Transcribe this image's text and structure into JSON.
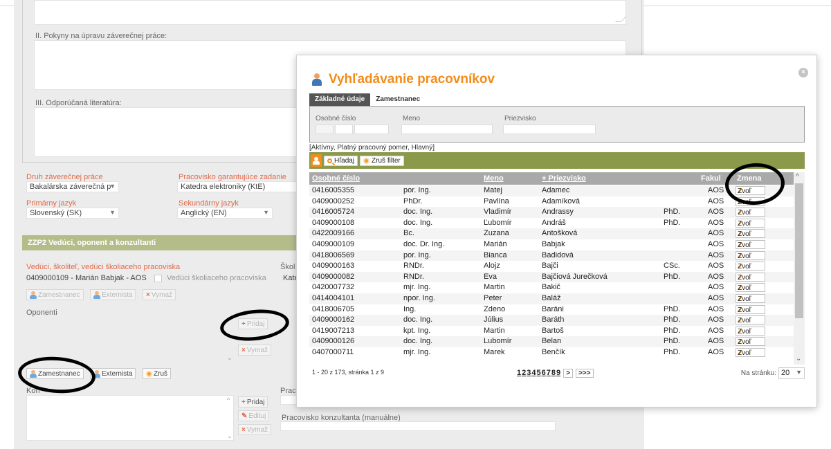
{
  "form": {
    "section2_label": "II. Pokyny na úpravu záverečnej práce:",
    "section3_label": "III. Odporúčaná literatúra:",
    "druh_label": "Druh záverečnej práce",
    "druh_value": "Bakalárska záverečná p",
    "pracovisko_label": "Pracovisko garantujúce zadanie",
    "pracovisko_value": "Katedra elektroniky (KtE)",
    "primarny_label": "Primárny jazyk",
    "primarny_value": "Slovenský (SK)",
    "sekundarny_label": "Sekundárny jazyk",
    "sekundarny_value": "Anglický (EN)",
    "zzp2_title": "ZZP2 Vedúci, oponent a konzultanti",
    "veduci_label": "Vedúci, školiteľ, vedúci školiaceho pracoviska",
    "veduci_value": "0409000109 - Marián Babjak - AOS",
    "veduci_checkbox_label": "Vedúci školiaceho pracoviska",
    "skol_label_partial": "Škol",
    "kat_partial": "Kate",
    "btn_zamestnanec": "Zamestnanec",
    "btn_externista": "Externista",
    "btn_vymaz": "Vymaž",
    "oponenti_label": "Oponenti",
    "btn_pridaj": "Pridaj",
    "btn_zrus": "Zruš",
    "konzultanti_label_partial": "Kon",
    "prac_partial": "Prac",
    "btn_edituj": "Edituj",
    "pracovisko_konzultanta_label": "Pracovisko konzultanta (manuálne)"
  },
  "modal": {
    "title": "Vyhľadávanie pracovníkov",
    "close_symbol": "×",
    "tabs": [
      "Základné údaje",
      "Zamestnanec"
    ],
    "filter_osobne": "Osobné číslo",
    "filter_meno": "Meno",
    "filter_priezvisko": "Priezvisko",
    "criteria": "[Aktívny, Platný pracovný pomer, Hlavný]",
    "btn_hladaj": "Hľadaj",
    "btn_zrus_filter": "Zruš filter",
    "columns": {
      "osobne": "Osobné číslo",
      "meno": "Meno",
      "priezvisko": "+ Priezvisko",
      "fakulta": "Fakul",
      "zmena": "Zmena"
    },
    "zvol_label": "Zvoľ",
    "rows": [
      [
        "0416005355",
        "por. Ing.",
        "Matej",
        "Adamec",
        "",
        "AOS"
      ],
      [
        "0409000252",
        "PhDr.",
        "Pavlína",
        "Adamíková",
        "",
        "AOS"
      ],
      [
        "0416005724",
        "doc. Ing.",
        "Vladimír",
        "Andrassy",
        "PhD.",
        "AOS"
      ],
      [
        "0409000108",
        "doc. Ing.",
        "Ľubomír",
        "Andráš",
        "PhD.",
        "AOS"
      ],
      [
        "0422009166",
        "Bc.",
        "Zuzana",
        "Antošková",
        "",
        "AOS"
      ],
      [
        "0409000109",
        "doc. Dr. Ing.",
        "Marián",
        "Babjak",
        "",
        "AOS"
      ],
      [
        "0418006569",
        "por. Ing.",
        "Bianca",
        "Badidová",
        "",
        "AOS"
      ],
      [
        "0409000163",
        "RNDr.",
        "Alojz",
        "Bajči",
        "CSc.",
        "AOS"
      ],
      [
        "0409000082",
        "RNDr.",
        "Eva",
        "Bajčiová Jurečková",
        "PhD.",
        "AOS"
      ],
      [
        "0420007732",
        "mjr. Ing.",
        "Martin",
        "Bakič",
        "",
        "AOS"
      ],
      [
        "0414004101",
        "npor. Ing.",
        "Peter",
        "Baláž",
        "",
        "AOS"
      ],
      [
        "0418006705",
        "Ing.",
        "Zdeno",
        "Baráni",
        "PhD.",
        "AOS"
      ],
      [
        "0409000162",
        "doc. Ing.",
        "Július",
        "Baráth",
        "PhD.",
        "AOS"
      ],
      [
        "0419007213",
        "kpt. Ing.",
        "Martin",
        "Bartoš",
        "PhD.",
        "AOS"
      ],
      [
        "0409000126",
        "doc. Ing.",
        "Lubomír",
        "Belan",
        "PhD.",
        "AOS"
      ],
      [
        "0407000711",
        "mjr. Ing.",
        "Marek",
        "Benčík",
        "PhD.",
        "AOS"
      ]
    ],
    "pager_info": "1 - 20 z 173, stránka 1 z 9",
    "pages": [
      "1",
      "2",
      "3",
      "4",
      "5",
      "6",
      "7",
      "8",
      "9"
    ],
    "pager_next": ">",
    "pager_last": ">>>",
    "per_page_label": "Na stránku:",
    "per_page_value": "20"
  }
}
